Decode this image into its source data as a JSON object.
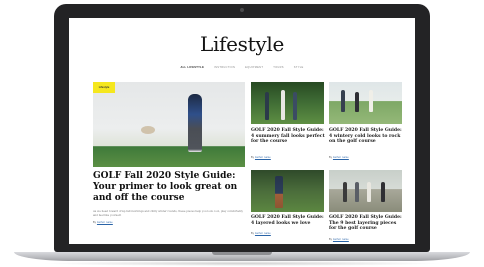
{
  "page": {
    "title": "Lifestyle"
  },
  "subnav": {
    "items": [
      "All Lifestyle",
      "Instruction",
      "Equipment",
      "Tours",
      "Style"
    ],
    "active_index": 0
  },
  "hero": {
    "badge": "Lifestyle",
    "headline": "GOLF Fall 2020 Style Guide: Your primer to look great on and off the course",
    "teaser": "As we head toward crisp fall mornings and chilly winter rounds, these pieces help you look cool, play comfortably and feel like yourself.",
    "byline_prefix": "By",
    "author": "Author name"
  },
  "cards": [
    {
      "headline": "GOLF 2020 Fall Style Guide: 4 summery fall looks perfect for the course",
      "byline_prefix": "By",
      "author": "Author name"
    },
    {
      "headline": "GOLF 2020 Fall Style Guide: 4 wintery cold looks to rock on the golf course",
      "byline_prefix": "By",
      "author": "Author name"
    },
    {
      "headline": "GOLF 2020 Fall Style Guide: 4 layered looks we love",
      "byline_prefix": "By",
      "author": "Author name"
    },
    {
      "headline": "GOLF 2020 Fall Style Guide: The 9 best layering pieces for the golf course",
      "byline_prefix": "By",
      "author": "Author name"
    }
  ],
  "colors": {
    "badge": "#f5e71e",
    "author_link": "#2a64a8",
    "bezel": "#232325"
  }
}
